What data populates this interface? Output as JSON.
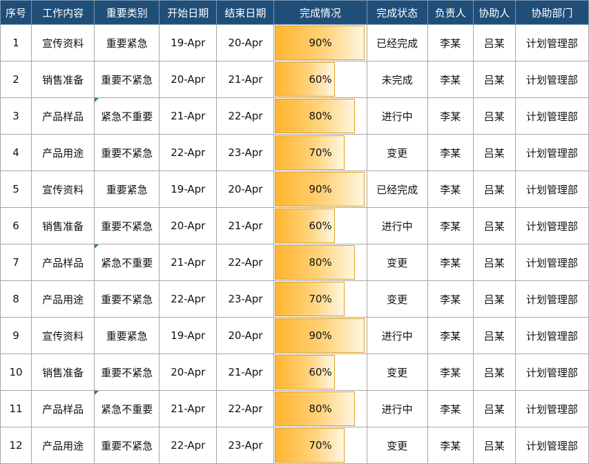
{
  "headers": [
    "序号",
    "工作内容",
    "重要类别",
    "开始日期",
    "结束日期",
    "完成情况",
    "完成状态",
    "负责人",
    "协助人",
    "协助部门"
  ],
  "rows": [
    {
      "seq": "1",
      "work": "宣传资料",
      "category": "重要紧急",
      "start": "19-Apr",
      "end": "20-Apr",
      "progress": "90%",
      "progress_value": 0.9,
      "status": "已经完成",
      "owner": "李某",
      "assistant": "吕某",
      "dept": "计划管理部",
      "flag": false
    },
    {
      "seq": "2",
      "work": "销售准备",
      "category": "重要不紧急",
      "start": "20-Apr",
      "end": "21-Apr",
      "progress": "60%",
      "progress_value": 0.6,
      "status": "未完成",
      "owner": "李某",
      "assistant": "吕某",
      "dept": "计划管理部",
      "flag": false
    },
    {
      "seq": "3",
      "work": "产品样品",
      "category": "紧急不重要",
      "start": "21-Apr",
      "end": "22-Apr",
      "progress": "80%",
      "progress_value": 0.8,
      "status": "进行中",
      "owner": "李某",
      "assistant": "吕某",
      "dept": "计划管理部",
      "flag": true
    },
    {
      "seq": "4",
      "work": "产品用途",
      "category": "重要不紧急",
      "start": "22-Apr",
      "end": "23-Apr",
      "progress": "70%",
      "progress_value": 0.7,
      "status": "变更",
      "owner": "李某",
      "assistant": "吕某",
      "dept": "计划管理部",
      "flag": false
    },
    {
      "seq": "5",
      "work": "宣传资料",
      "category": "重要紧急",
      "start": "19-Apr",
      "end": "20-Apr",
      "progress": "90%",
      "progress_value": 0.9,
      "status": "已经完成",
      "owner": "李某",
      "assistant": "吕某",
      "dept": "计划管理部",
      "flag": false
    },
    {
      "seq": "6",
      "work": "销售准备",
      "category": "重要不紧急",
      "start": "20-Apr",
      "end": "21-Apr",
      "progress": "60%",
      "progress_value": 0.6,
      "status": "进行中",
      "owner": "李某",
      "assistant": "吕某",
      "dept": "计划管理部",
      "flag": false
    },
    {
      "seq": "7",
      "work": "产品样品",
      "category": "紧急不重要",
      "start": "21-Apr",
      "end": "22-Apr",
      "progress": "80%",
      "progress_value": 0.8,
      "status": "变更",
      "owner": "李某",
      "assistant": "吕某",
      "dept": "计划管理部",
      "flag": true
    },
    {
      "seq": "8",
      "work": "产品用途",
      "category": "重要不紧急",
      "start": "22-Apr",
      "end": "23-Apr",
      "progress": "70%",
      "progress_value": 0.7,
      "status": "变更",
      "owner": "李某",
      "assistant": "吕某",
      "dept": "计划管理部",
      "flag": false
    },
    {
      "seq": "9",
      "work": "宣传资料",
      "category": "重要紧急",
      "start": "19-Apr",
      "end": "20-Apr",
      "progress": "90%",
      "progress_value": 0.9,
      "status": "进行中",
      "owner": "李某",
      "assistant": "吕某",
      "dept": "计划管理部",
      "flag": false
    },
    {
      "seq": "10",
      "work": "销售准备",
      "category": "重要不紧急",
      "start": "20-Apr",
      "end": "21-Apr",
      "progress": "60%",
      "progress_value": 0.6,
      "status": "变更",
      "owner": "李某",
      "assistant": "吕某",
      "dept": "计划管理部",
      "flag": false
    },
    {
      "seq": "11",
      "work": "产品样品",
      "category": "紧急不重要",
      "start": "21-Apr",
      "end": "22-Apr",
      "progress": "80%",
      "progress_value": 0.8,
      "status": "进行中",
      "owner": "李某",
      "assistant": "吕某",
      "dept": "计划管理部",
      "flag": true
    },
    {
      "seq": "12",
      "work": "产品用途",
      "category": "重要不紧急",
      "start": "22-Apr",
      "end": "23-Apr",
      "progress": "70%",
      "progress_value": 0.7,
      "status": "变更",
      "owner": "李某",
      "assistant": "吕某",
      "dept": "计划管理部",
      "flag": false
    }
  ],
  "colors": {
    "header_bg": "#1f4e79",
    "bar_start": "#ffb52e",
    "bar_end": "#fff6e2",
    "flag": "#1e8e3e"
  }
}
